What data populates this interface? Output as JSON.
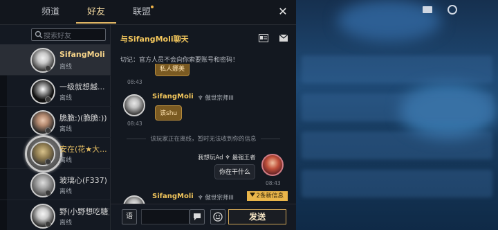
{
  "tabs": [
    {
      "label": "频道",
      "active": false
    },
    {
      "label": "好友",
      "active": true
    },
    {
      "label": "联盟",
      "active": false,
      "dot": true
    }
  ],
  "search": {
    "placeholder": "搜索好友"
  },
  "friends": [
    {
      "name": "SifangMoli",
      "status": "离线",
      "active": true,
      "highlight": true
    },
    {
      "name": "一级就想越...",
      "status": "离线"
    },
    {
      "name": "脆脆:)(脆脆:))",
      "status": "离线"
    },
    {
      "name": "安在(花★大...",
      "status": "离线",
      "gold": true,
      "bigframe": true
    },
    {
      "name": "玻璃心(F337)",
      "status": "离线"
    },
    {
      "name": "野(小野想吃糖)",
      "status": "离线"
    }
  ],
  "chat": {
    "title": "与SifangMoli聊天",
    "notice": "切记：官方人员不会向你索要账号和密码！",
    "messages": [
      {
        "side": "left",
        "text": "私人娜美",
        "time": "08:43"
      },
      {
        "side": "left",
        "name": "SifangMoli",
        "rank": "傲世宗师III",
        "text": "该shu",
        "time": "08:43"
      },
      {
        "side": "right",
        "name": "我想玩Ad",
        "rank": "最强王者",
        "text": "你在干什么",
        "time": "08:43"
      },
      {
        "side": "left",
        "name": "SifangMoli",
        "rank": "傲世宗师III"
      }
    ],
    "system_text": "该玩家正在离线，暂时无法收到你的信息",
    "new_messages": "2条新信息",
    "send_label": "发送",
    "voice_label": "语"
  },
  "colors": {
    "accent": "#e3b866",
    "name": "#f2c65c",
    "bubble": "#7a5a22"
  }
}
